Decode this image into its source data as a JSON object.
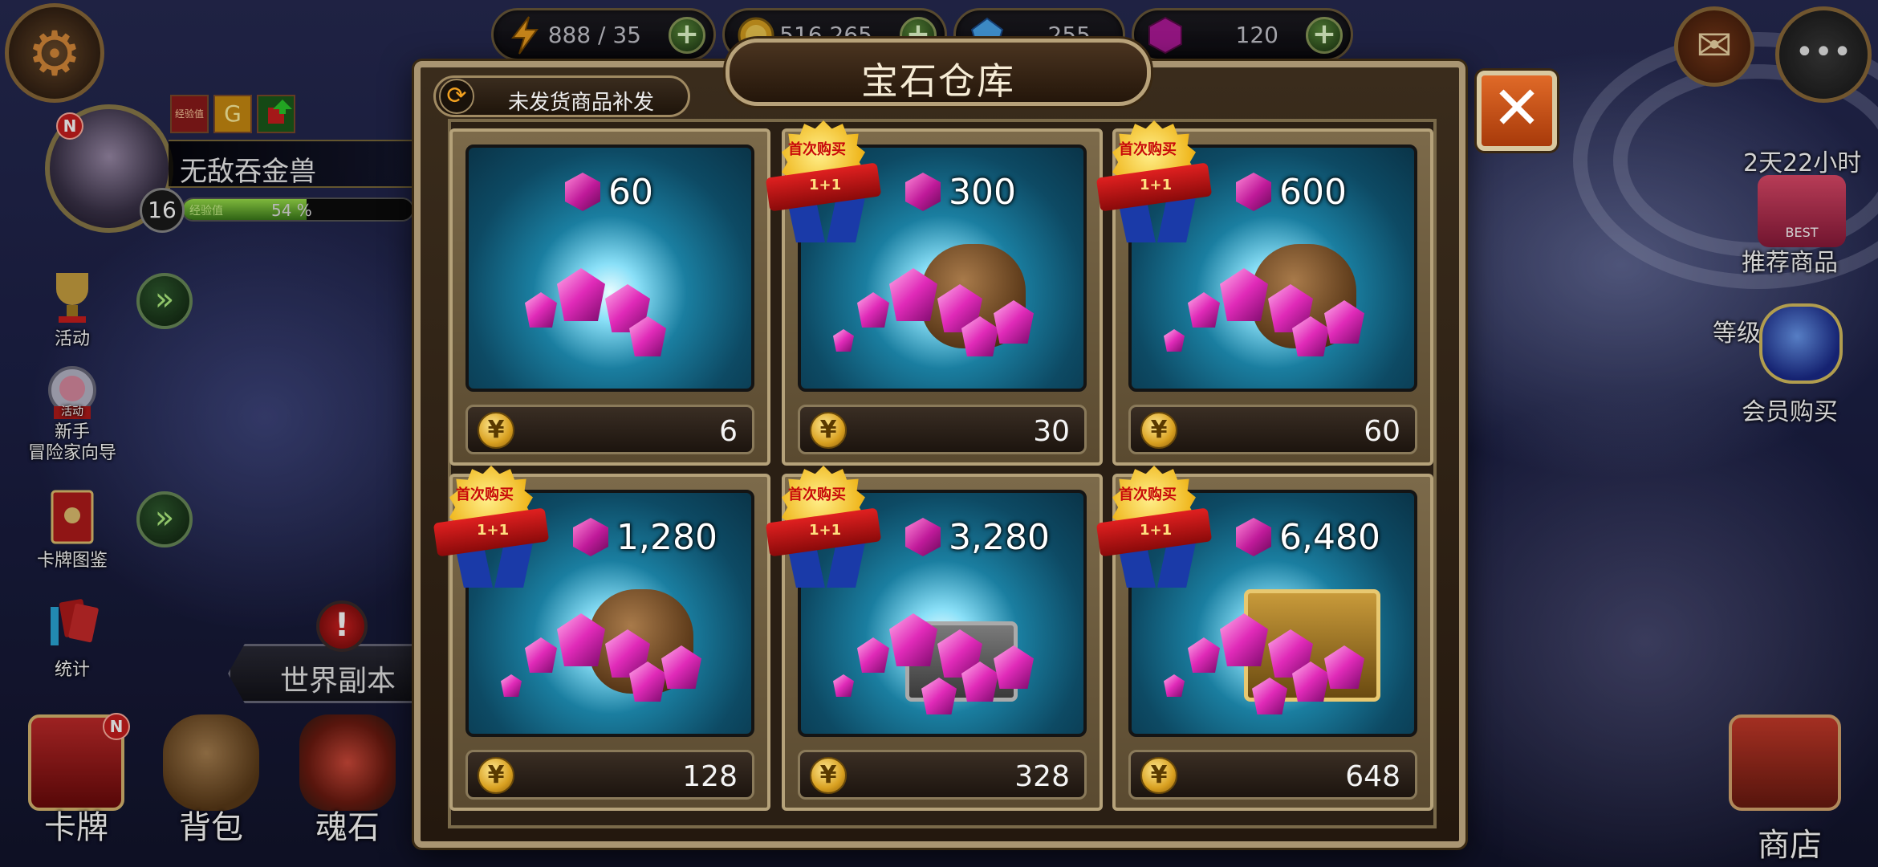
{
  "resources": [
    {
      "name": "stamina",
      "value": "888 / 35",
      "icon": "lightning-icon",
      "color": "#f0a020"
    },
    {
      "name": "gold",
      "value": "516,265",
      "icon": "gold-coin-icon",
      "color": "#d8a020"
    },
    {
      "name": "crystal",
      "value": "255",
      "icon": "blue-crystal-icon",
      "color": "#4aa8f0"
    },
    {
      "name": "gem",
      "value": "120",
      "icon": "purple-gem-icon",
      "color": "#c01a9a"
    }
  ],
  "player": {
    "name": "无敌吞金兽",
    "level": "16",
    "exp_label": "经验值",
    "exp_percent_text": "54 %",
    "exp_fraction": 0.54,
    "new_badge": "N"
  },
  "buffs": [
    {
      "icon": "exp-buff-icon",
      "label": "经验值"
    },
    {
      "icon": "gold-buff-icon",
      "label": "G"
    },
    {
      "icon": "upgrade-buff-icon",
      "label": ""
    }
  ],
  "left_menu": [
    {
      "label": "活动"
    },
    {
      "label_top": "新手",
      "label": "冒险家向导",
      "tag": "活动"
    },
    {
      "label": "卡牌图鉴"
    },
    {
      "label": "统计"
    }
  ],
  "world_button": {
    "label": "世界副本",
    "alert": "!"
  },
  "bottom_nav": [
    {
      "label": "卡牌",
      "badge": "N"
    },
    {
      "label": "背包"
    },
    {
      "label": "魂石"
    }
  ],
  "right_hud": {
    "timer": "2天22小时",
    "recommend_label": "推荐商品",
    "recommend_tag": "BEST",
    "level_label": "等级",
    "vip_label": "会员购买",
    "shop_label": "商店"
  },
  "modal": {
    "title": "宝石仓库",
    "reissue_label": "未发货商品补发",
    "close_label": "✕",
    "first_buy_text": "首次购买",
    "first_buy_bonus": "1+1",
    "currency_symbol": "¥",
    "packs": [
      {
        "gems": "60",
        "price": "6",
        "first_buy": false
      },
      {
        "gems": "300",
        "price": "30",
        "first_buy": true
      },
      {
        "gems": "600",
        "price": "60",
        "first_buy": true
      },
      {
        "gems": "1,280",
        "price": "128",
        "first_buy": true
      },
      {
        "gems": "3,280",
        "price": "328",
        "first_buy": true
      },
      {
        "gems": "6,480",
        "price": "648",
        "first_buy": true
      }
    ]
  }
}
